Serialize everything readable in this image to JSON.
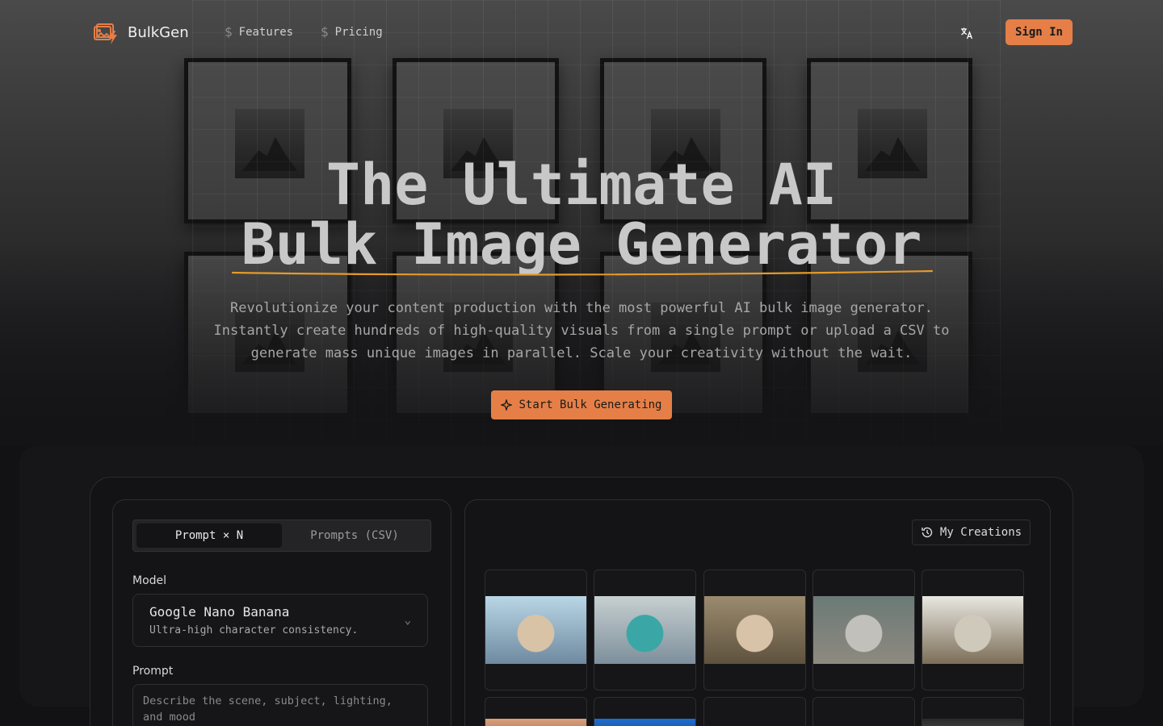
{
  "brand": {
    "name": "BulkGen"
  },
  "nav": {
    "features": "Features",
    "pricing": "Pricing",
    "sign_in": "Sign In",
    "translate_icon": "translate-icon"
  },
  "hero": {
    "title_line1": "The Ultimate AI",
    "title_line2": "Bulk Image Generator",
    "subtitle": "Revolutionize your content production with the most powerful AI bulk image generator. Instantly create hundreds of high-quality visuals from a single prompt or upload a CSV to generate mass unique images in parallel. Scale your creativity without the wait.",
    "cta": "Start Bulk Generating"
  },
  "generator": {
    "tabs": [
      {
        "label": "Prompt × N",
        "active": true
      },
      {
        "label": "Prompts (CSV)",
        "active": false
      }
    ],
    "model_label": "Model",
    "model": {
      "name": "Google Nano Banana",
      "description": "Ultra-high character consistency."
    },
    "prompt_label": "Prompt",
    "prompt_placeholder": "Describe the scene, subject, lighting, and mood",
    "prompt_value": ""
  },
  "gallery": {
    "my_creations": "My Creations",
    "thumbnails": [
      {
        "subject": "child-beach",
        "colors": [
          "#b9d6e6",
          "#d9c3a6",
          "#6f8aa0"
        ]
      },
      {
        "subject": "teal-hair-woman",
        "colors": [
          "#c7cfd0",
          "#3aa7a6",
          "#7d8f9c"
        ]
      },
      {
        "subject": "girl-sepia",
        "colors": [
          "#9b8a6e",
          "#d8c2a8",
          "#5e523f"
        ]
      },
      {
        "subject": "girl-sweater",
        "colors": [
          "#6b7a76",
          "#c2c0bb",
          "#8e8a80"
        ]
      },
      {
        "subject": "toddler-teepee",
        "colors": [
          "#e9e7e1",
          "#cfc9bc",
          "#7c6e58"
        ]
      },
      {
        "subject": "portrait-warm",
        "colors": [
          "#d9a07e",
          "#b86e4a",
          "#8a4d33"
        ]
      },
      {
        "subject": "flag-blue",
        "colors": [
          "#1c6fd6",
          "#d8382f",
          "#2a2a2a"
        ]
      },
      {
        "subject": "empty",
        "colors": [
          "#161618",
          "#161618",
          "#161618"
        ]
      },
      {
        "subject": "empty",
        "colors": [
          "#161618",
          "#161618",
          "#161618"
        ]
      },
      {
        "subject": "robot-helmet",
        "colors": [
          "#2a2a2a",
          "#d8d8d8",
          "#6a6a6a"
        ]
      }
    ]
  },
  "colors": {
    "accent": "#e57f47",
    "underline": "#e59a2a",
    "background": "#121214"
  }
}
